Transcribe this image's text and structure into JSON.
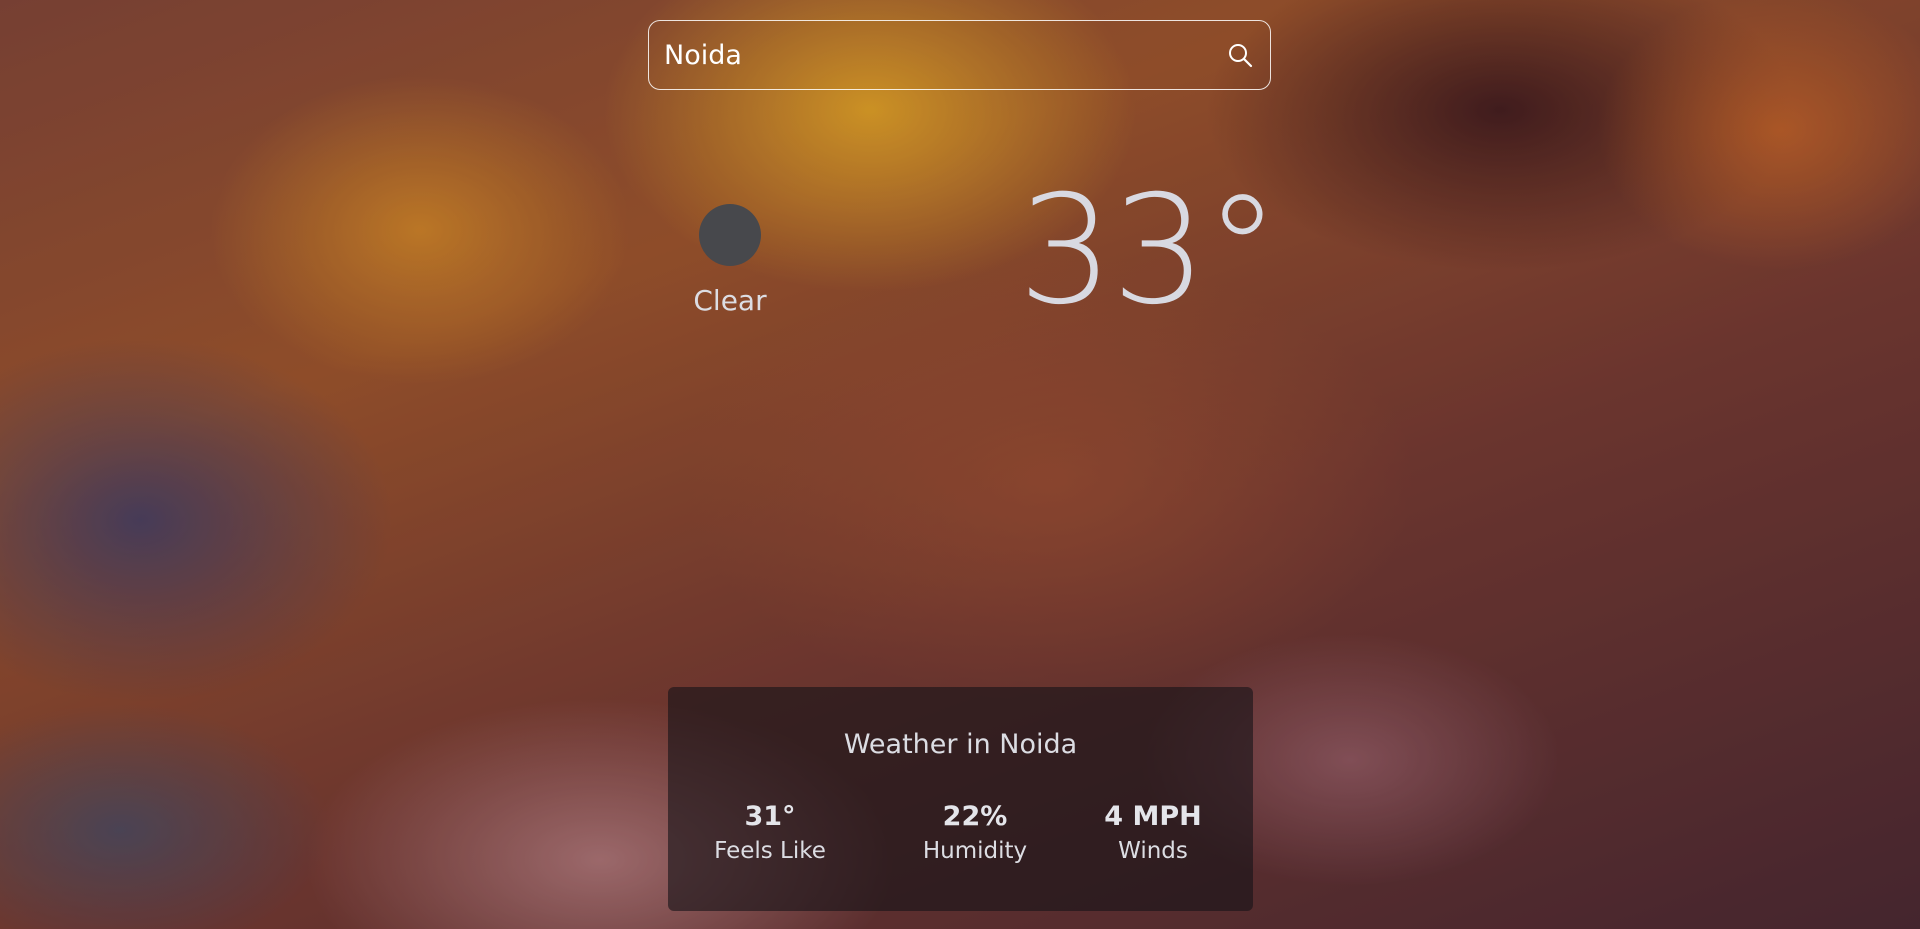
{
  "search": {
    "value": "Noida",
    "icon": "search-icon"
  },
  "current": {
    "condition": "Clear",
    "temperature": "33°"
  },
  "card": {
    "title": "Weather in Noida",
    "stats": [
      {
        "value": "31°",
        "label": "Feels Like"
      },
      {
        "value": "22%",
        "label": "Humidity"
      },
      {
        "value": "4 MPH",
        "label": "Winds"
      }
    ]
  },
  "colors": {
    "text": "#dcdde3",
    "icon_placeholder": "#47484c",
    "card_background": "rgba(22,20,24,0.62)"
  }
}
